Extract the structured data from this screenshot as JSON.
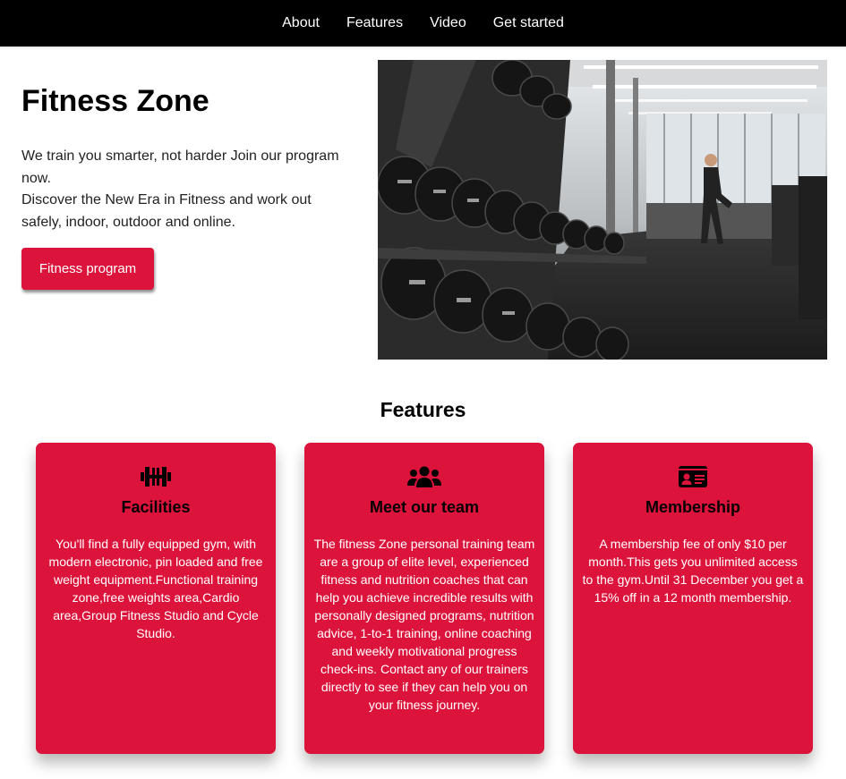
{
  "nav": {
    "items": [
      {
        "label": "About"
      },
      {
        "label": "Features"
      },
      {
        "label": "Video"
      },
      {
        "label": "Get started"
      }
    ]
  },
  "hero": {
    "title": "Fitness Zone",
    "line1": "We train you smarter, not harder Join our program now.",
    "line2": "Discover the New Era in Fitness and work out safely, indoor, outdoor and online.",
    "button_label": "Fitness program",
    "image_subject": "gym interior with dumbbell racks"
  },
  "features": {
    "title": "Features",
    "cards": [
      {
        "icon": "dumbbell-icon",
        "title": "Facilities",
        "text": "You'll find a fully equipped gym, with modern electronic, pin loaded and free weight equipment.Functional training zone,free weights area,Cardio area,Group Fitness Studio and Cycle Studio."
      },
      {
        "icon": "users-icon",
        "title": "Meet our team",
        "text": "The fitness Zone personal training team are a group of elite level, experienced fitness and nutrition coaches that can help you achieve incredible results with personally designed programs, nutrition advice, 1-to-1 training, online coaching and weekly motivational progress check-ins. Contact any of our trainers directly to see if they can help you on your fitness journey."
      },
      {
        "icon": "id-card-icon",
        "title": "Membership",
        "text": "A membership fee of only $10 per month.This gets you unlimited access to the gym.Until 31 December you get a 15% off in a 12 month membership."
      }
    ]
  },
  "colors": {
    "accent": "#dc143c",
    "navbar": "#000000"
  }
}
